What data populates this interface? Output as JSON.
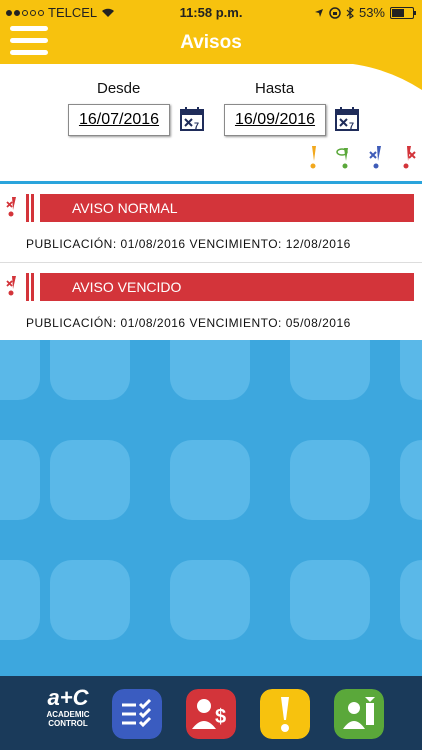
{
  "status_bar": {
    "carrier": "TELCEL",
    "time": "11:58 p.m.",
    "battery": "53%"
  },
  "header": {
    "title": "Avisos"
  },
  "filters": {
    "desde_label": "Desde",
    "desde_value": "16/07/2016",
    "hasta_label": "Hasta",
    "hasta_value": "16/09/2016"
  },
  "avisos": [
    {
      "title": "AVISO NORMAL",
      "publicacion_label": "PUBLICACIÓN:",
      "publicacion": "01/08/2016",
      "vencimiento_label": "VENCIMIENTO:",
      "vencimiento": "12/08/2016"
    },
    {
      "title": "AVISO VENCIDO",
      "publicacion_label": "PUBLICACIÓN:",
      "publicacion": "01/08/2016",
      "vencimiento_label": "VENCIMIENTO:",
      "vencimiento": "05/08/2016"
    }
  ],
  "dock": {
    "logo_line1": "ACADEMIC",
    "logo_line2": "CONTROL"
  },
  "colors": {
    "yellow": "#f7c20e",
    "red": "#d3343a",
    "blue": "#3da7de",
    "green": "#5aa83a",
    "navy": "#1a3a5a"
  }
}
